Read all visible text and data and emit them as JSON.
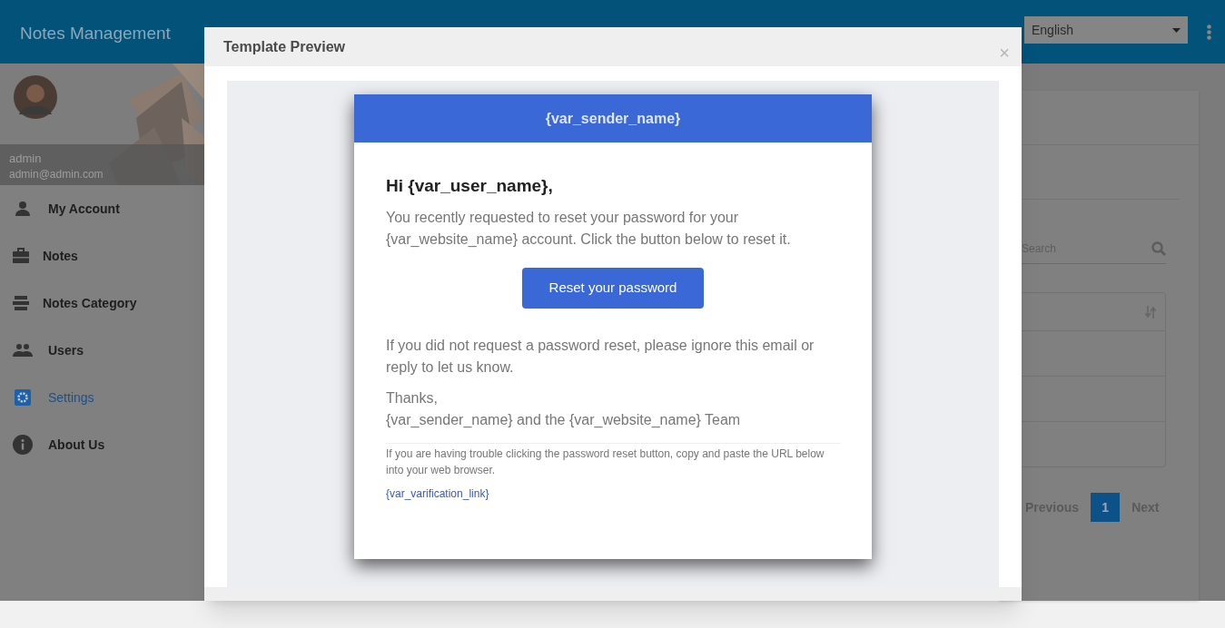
{
  "app": {
    "title": "Notes Management",
    "language": "English"
  },
  "profile": {
    "name": "admin",
    "email": "admin@admin.com"
  },
  "sidebar": {
    "items": [
      {
        "label": "My Account",
        "kind": "person",
        "selected": false
      },
      {
        "label": "Notes",
        "kind": "briefcase",
        "selected": false
      },
      {
        "label": "Notes Category",
        "kind": "stack",
        "selected": false
      },
      {
        "label": "Users",
        "kind": "users",
        "selected": false
      },
      {
        "label": "Settings",
        "kind": "gear",
        "selected": true
      },
      {
        "label": "About Us",
        "kind": "info",
        "selected": false
      }
    ]
  },
  "background_card": {
    "search": {
      "placeholder": "Search"
    },
    "pagination": {
      "previous": "Previous",
      "pages": [
        {
          "label": "1",
          "selected": true
        }
      ],
      "next": "Next"
    }
  },
  "modal": {
    "title": "Template Preview",
    "close": "×",
    "email": {
      "header": "{var_sender_name}",
      "greeting": "Hi {var_user_name},",
      "intro": "You recently requested to reset your password for your {var_website_name} account. Click the button below to reset it.",
      "button": "Reset your password",
      "ignore": "If you did not request a password reset, please ignore this email or reply to let us know.",
      "thanks": "Thanks,",
      "signature": "{var_sender_name} and the {var_website_name} Team",
      "trouble": "If you are having trouble clicking the password reset button, copy and paste the URL below into your web browser.",
      "link": "{var_varification_link}"
    }
  }
}
